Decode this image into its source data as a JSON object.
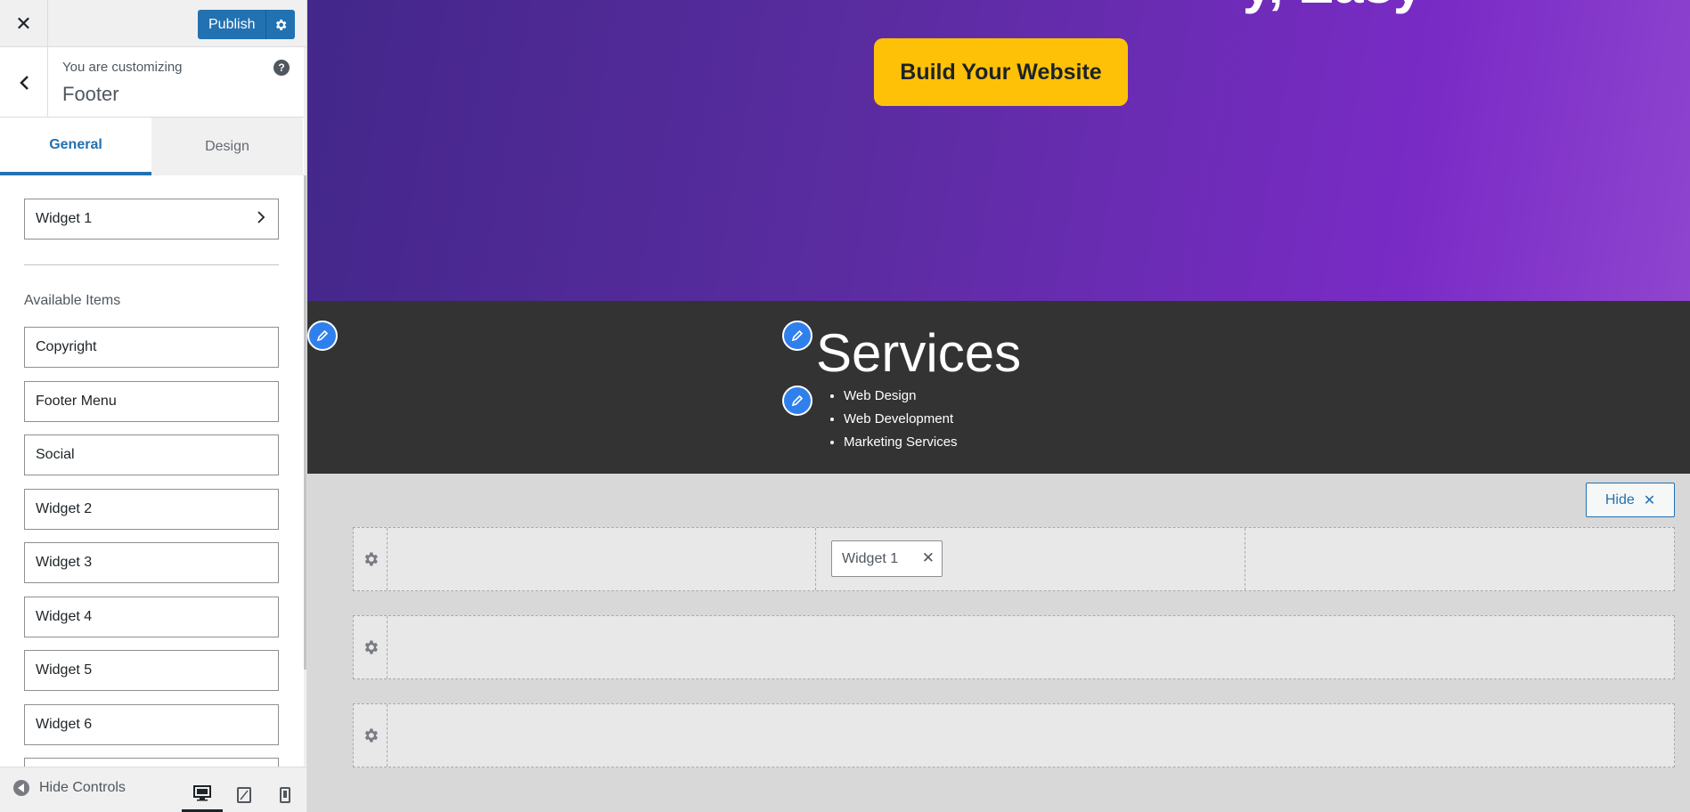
{
  "topbar": {
    "close_icon": "close-icon",
    "publish_label": "Publish",
    "settings_icon": "gear-icon"
  },
  "header": {
    "customizing_label": "You are customizing",
    "section_title": "Footer",
    "help_icon": "?"
  },
  "tabs": [
    {
      "label": "General",
      "active": true
    },
    {
      "label": "Design",
      "active": false
    }
  ],
  "panel": {
    "current_item": "Widget 1",
    "available_label": "Available Items",
    "available_items": [
      "Copyright",
      "Footer Menu",
      "Social",
      "Widget 2",
      "Widget 3",
      "Widget 4",
      "Widget 5",
      "Widget 6"
    ]
  },
  "bottombar": {
    "hide_controls_label": "Hide Controls",
    "devices": [
      "desktop",
      "tablet",
      "mobile"
    ],
    "active_device": "desktop"
  },
  "preview": {
    "hero_partial_text": "y, Easy",
    "cta_label": "Build Your Website",
    "services_title": "Services",
    "services": [
      "Web Design",
      "Web Development",
      "Marketing Services"
    ],
    "hide_label": "Hide",
    "hide_icon": "✕",
    "chip_label": "Widget 1",
    "chip_remove": "✕"
  },
  "colors": {
    "accent": "#2271b1",
    "cta": "#ffc107",
    "dark_band": "#333333",
    "hero_start": "#43278a",
    "hero_end": "#8f45cf"
  }
}
